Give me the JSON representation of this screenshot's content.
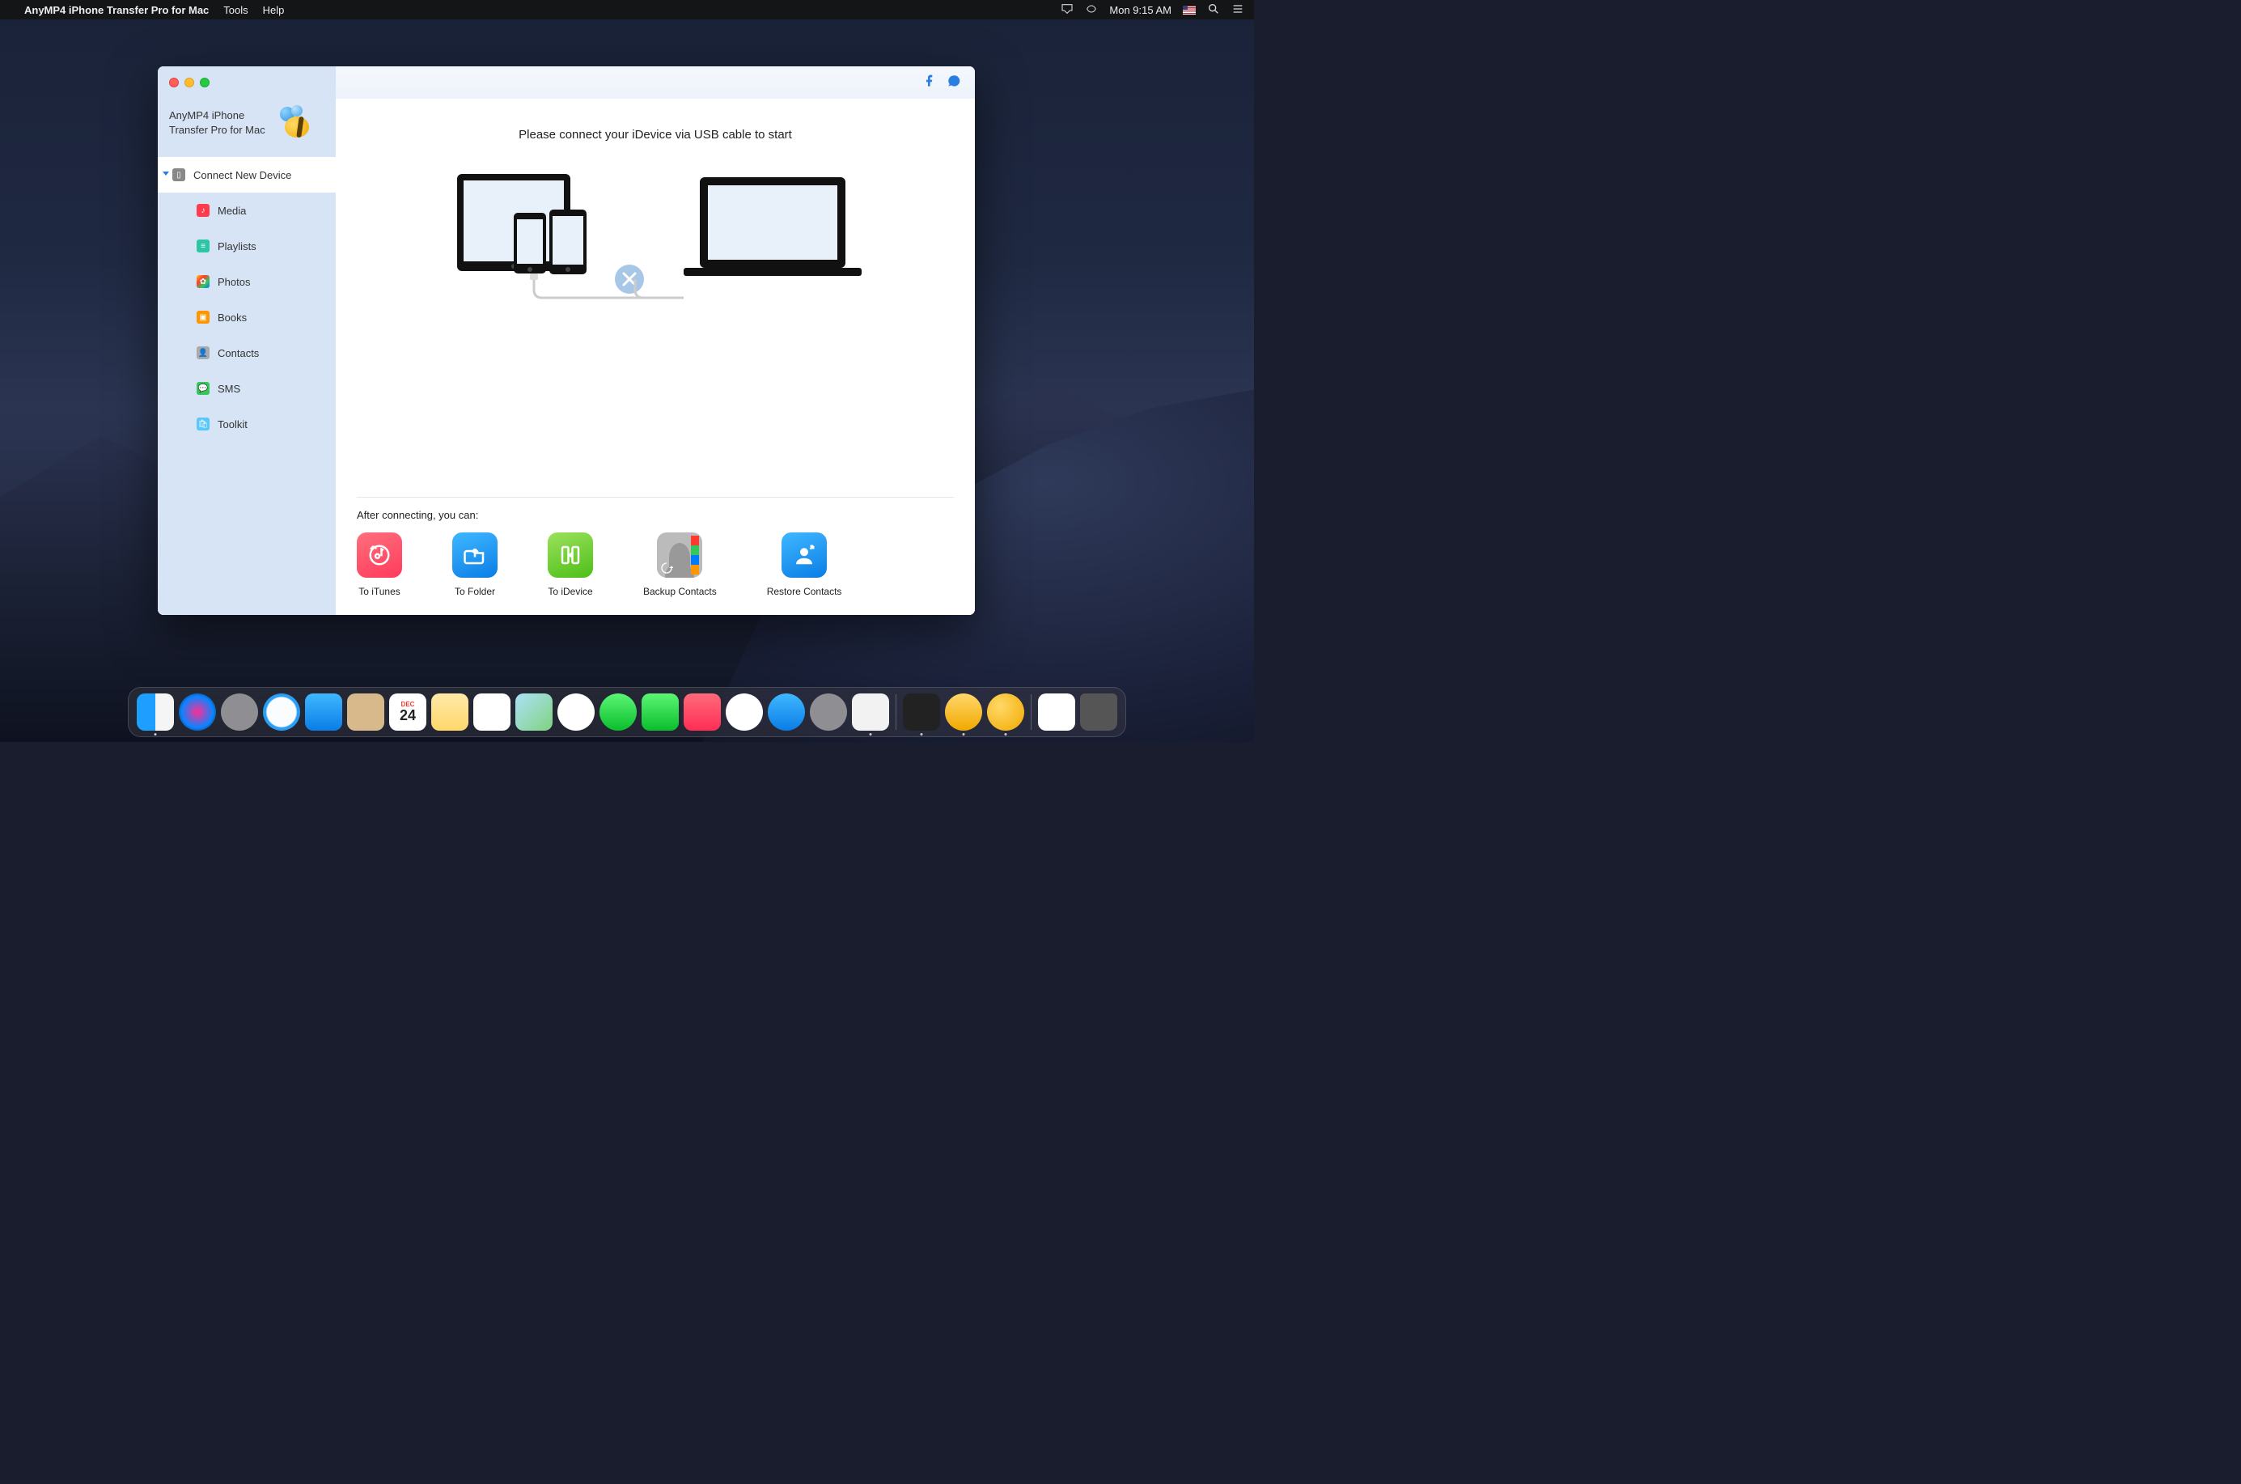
{
  "menubar": {
    "app_name": "AnyMP4 iPhone Transfer Pro for Mac",
    "items": [
      "Tools",
      "Help"
    ],
    "clock": "Mon 9:15 AM"
  },
  "sidebar": {
    "app_title_line1": "AnyMP4 iPhone",
    "app_title_line2": "Transfer Pro for Mac",
    "root": "Connect New Device",
    "items": [
      {
        "label": "Media",
        "icon": "media"
      },
      {
        "label": "Playlists",
        "icon": "playlists"
      },
      {
        "label": "Photos",
        "icon": "photos"
      },
      {
        "label": "Books",
        "icon": "books"
      },
      {
        "label": "Contacts",
        "icon": "contacts"
      },
      {
        "label": "SMS",
        "icon": "sms"
      },
      {
        "label": "Toolkit",
        "icon": "toolkit"
      }
    ]
  },
  "main": {
    "connect_message": "Please connect your iDevice via USB cable to start",
    "after_title": "After connecting, you can:",
    "actions": [
      {
        "label": "To iTunes",
        "icon": "itunes"
      },
      {
        "label": "To Folder",
        "icon": "folder"
      },
      {
        "label": "To iDevice",
        "icon": "idevice"
      },
      {
        "label": "Backup Contacts",
        "icon": "backup"
      },
      {
        "label": "Restore Contacts",
        "icon": "restore"
      }
    ]
  },
  "dock": {
    "calendar_month": "DEC",
    "calendar_day": "24"
  }
}
